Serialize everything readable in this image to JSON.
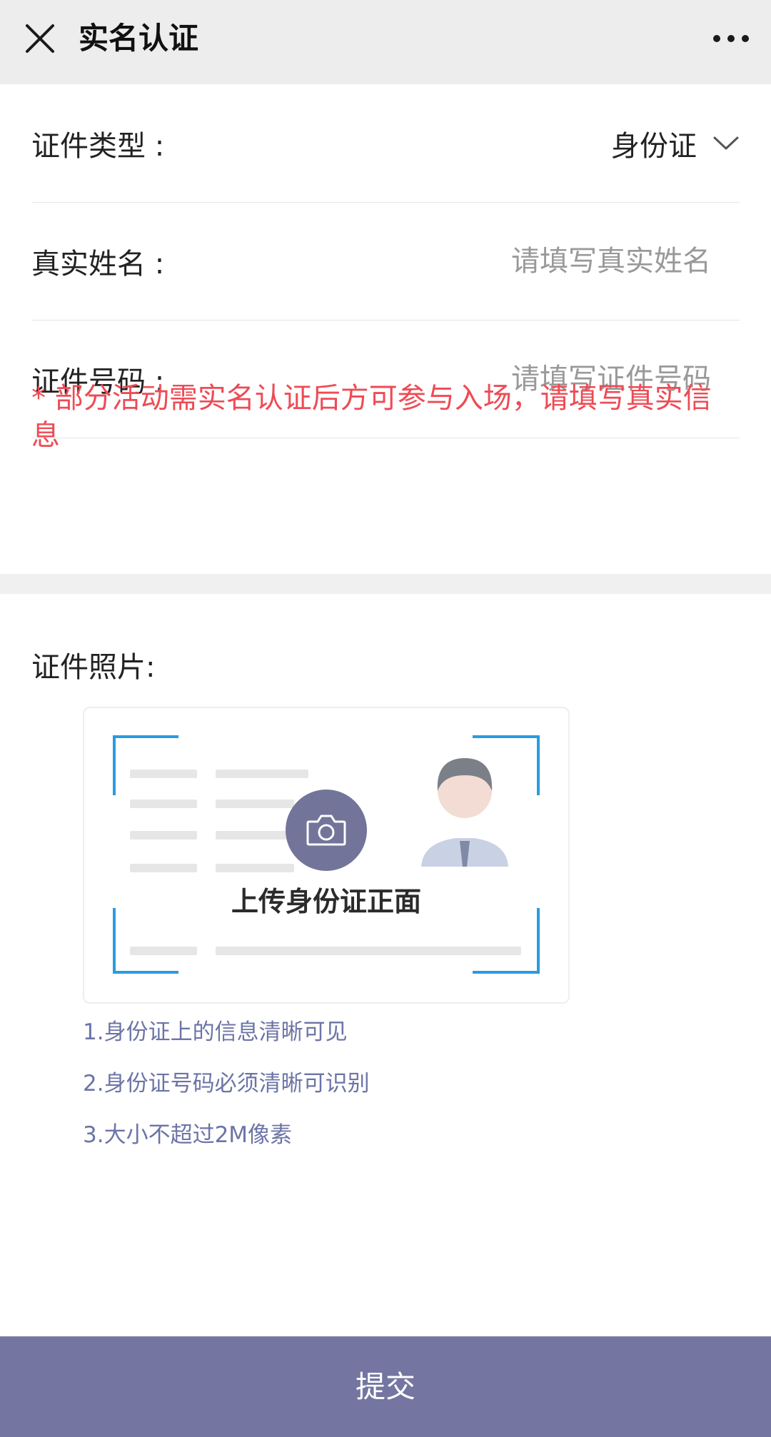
{
  "navbar": {
    "close_icon": "close-icon",
    "title": "实名认证",
    "more_icon": "more-icon"
  },
  "form": {
    "id_type": {
      "label": "证件类型 :",
      "value": "身份证",
      "icon": "chevron-down-icon"
    },
    "real_name": {
      "label": "真实姓名 :",
      "placeholder": "请填写真实姓名",
      "value": ""
    },
    "id_number": {
      "label": "证件号码 :",
      "placeholder": "请填写证件号码",
      "value": ""
    },
    "notice": "* 部分活动需实名认证后方可参与入场，请填写真实信息"
  },
  "photo": {
    "label": "证件照片:",
    "upload_text": "上传身份证正面",
    "camera_icon": "camera-icon",
    "tips": [
      "1.身份证上的信息清晰可见",
      "2.身份证号码必须清晰可识别",
      "3.大小不超过2M像素"
    ]
  },
  "submit_label": "提交",
  "colors": {
    "accent": "#7476a1",
    "notice": "#ee4b55",
    "tip": "#6c74a6",
    "frame": "#2a9be0",
    "navbar_bg": "#ededed"
  }
}
